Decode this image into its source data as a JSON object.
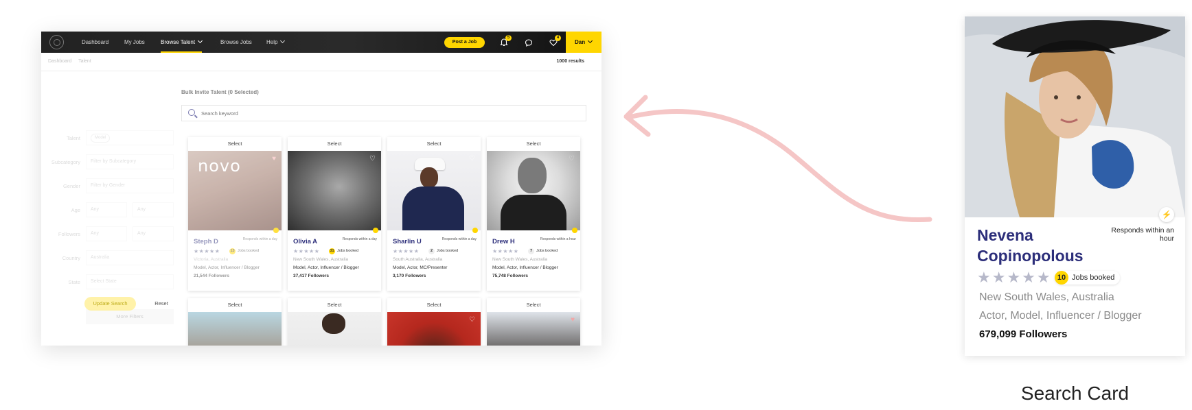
{
  "nav": {
    "links": [
      "Dashboard",
      "My Jobs",
      "Browse Talent",
      "Browse Jobs",
      "Help"
    ],
    "post_job": "Post a Job",
    "notif_count": "5",
    "fav_count": "4",
    "user": "Dan"
  },
  "breadcrumb": [
    "Dashboard",
    "Talent"
  ],
  "results": "1000 results",
  "filters": {
    "talent_label": "Talent",
    "talent_chip": "Model",
    "subcategory_label": "Subcategory",
    "subcategory_placeholder": "Filter by Subcategory",
    "gender_label": "Gender",
    "gender_placeholder": "Filter by Gender",
    "age_label": "Age",
    "age_min": "Any",
    "age_max": "Any",
    "followers_label": "Followers",
    "followers_min": "Any",
    "followers_max": "Any",
    "country_label": "Country",
    "country_value": "Australia",
    "state_label": "State",
    "state_placeholder": "Select State",
    "more": "More Filters",
    "update": "Update Search",
    "reset": "Reset"
  },
  "bulk_invite": "Bulk Invite Talent (0 Selected)",
  "search_placeholder": "Search keyword",
  "select_label": "Select",
  "cards": [
    {
      "name": "Steph D",
      "resp": "Responds within a day",
      "jobs": "13",
      "jobs_label": "Jobs booked",
      "location": "Victoria, Australia",
      "roles": "Model, Actor, Influencer / Blogger",
      "followers": "21,544 Followers",
      "photo_text": "novo"
    },
    {
      "name": "Olivia A",
      "resp": "Responds within a day",
      "jobs": "31",
      "jobs_label": "Jobs booked",
      "location": "New South Wales, Australia",
      "roles": "Model, Actor, Influencer / Blogger",
      "followers": "37,417 Followers"
    },
    {
      "name": "Sharlin U",
      "resp": "Responds within a day",
      "jobs": "2",
      "jobs_label": "Jobs booked",
      "location": "South Australia, Australia",
      "roles": "Model, Actor, MC/Presenter",
      "followers": "3,170 Followers"
    },
    {
      "name": "Drew H",
      "resp": "Responds within a hour",
      "jobs": "7",
      "jobs_label": "Jobs booked",
      "location": "New South Wales, Australia",
      "roles": "Model, Actor, Influencer / Blogger",
      "followers": "75,748 Followers"
    }
  ],
  "search_card": {
    "name": "Nevena Copinopolous",
    "resp": "Responds within an hour",
    "jobs": "10",
    "jobs_label": "Jobs booked",
    "location": "New South Wales, Australia",
    "roles": "Actor, Model, Influencer / Blogger",
    "followers": "679,099 Followers"
  },
  "caption": "Search Card",
  "colors": {
    "accent": "#ffd600",
    "name_blue": "#2c2e7a",
    "arrow": "#f5c6c6"
  }
}
